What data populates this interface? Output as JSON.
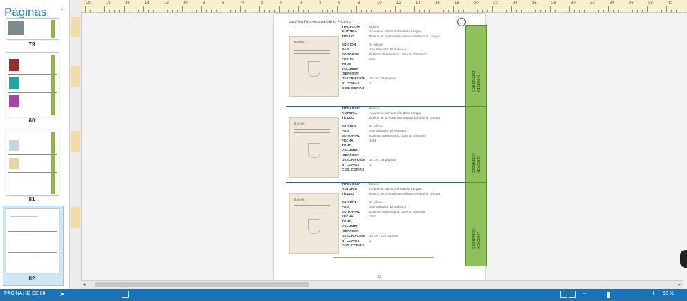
{
  "panel": {
    "title": "Páginas",
    "collapse_glyph": "‹",
    "thumbs": [
      {
        "page": "79"
      },
      {
        "page": "80"
      },
      {
        "page": "81"
      },
      {
        "page": "82",
        "selected": true
      }
    ]
  },
  "ruler": {
    "labels": [
      "20",
      "18",
      "16",
      "14",
      "12",
      "10",
      "8",
      "6",
      "4",
      "2",
      "0",
      "2",
      "4",
      "6",
      "8",
      "10",
      "12",
      "14",
      "16",
      "18",
      "20",
      "22",
      "24",
      "26",
      "28",
      "30",
      "32",
      "34",
      "36",
      "38",
      "40"
    ]
  },
  "document": {
    "header": "Archivo Documental de la Historia",
    "footer_page": "82",
    "field_labels": [
      "TIPOLOGÍA",
      "AUTORÍA",
      "TÍTULO",
      "EDICIÓN",
      "PAÍS",
      "EDITORIAL",
      "FECHA",
      "TOMO",
      "VOLUMEN",
      "ISBN/ISSN",
      "DESCRIPCIÓN",
      "Nº COPIAS",
      "COD. COPIAS"
    ],
    "entries": [
      {
        "cover_title": "Boletín",
        "values": [
          "Boletín",
          "Academia Salvadoreña de la Lengua",
          "Boletín de la Academia Salvadoreña de la Lengua",
          "1ª edición",
          "San Salvador, El Salvador",
          "Editorial Universitaria \"José B. Cisneros\"",
          "1964",
          "",
          "",
          "",
          "25 cm ; 45 páginas",
          "1",
          ""
        ],
        "code1": "CSB-BNS223",
        "code2": "HEM00346"
      },
      {
        "cover_title": "Boletín",
        "values": [
          "Boletín",
          "Academia Salvadoreña de la Lengua",
          "Boletín de la Academia Salvadoreña de la Lengua",
          "1ª edición",
          "San Salvador, El Salvador",
          "Editorial Universitaria \"José B. Cisneros\"",
          "1965",
          "",
          "",
          "",
          "25 cm ; 54 páginas",
          "1",
          ""
        ],
        "code1": "CSB-BNS224",
        "code2": "HEM00346"
      },
      {
        "cover_title": "Boletín",
        "values": [
          "Boletín",
          "Academia Salvadoreña de la Lengua",
          "Boletín de la Academia Salvadoreña de la Lengua",
          "1ª edición",
          "San Salvador, El Salvador",
          "Editorial Universitaria \"José B. Cisneros\"",
          "1967",
          "",
          "",
          "",
          "25 cm ; 104 páginas",
          "1",
          ""
        ],
        "code1": "CSB-BNS225",
        "code2": "HEM00347"
      }
    ]
  },
  "status": {
    "page_indicator": "PÁGINA: 82 DE 88",
    "zoom": "50 %",
    "zoom_minus": "−",
    "zoom_plus": "+",
    "accent": "#1a73b5"
  },
  "icons": {
    "cursor": "pointer-arrow-icon",
    "status_icon": "present-icon",
    "view1": "page-view-icon",
    "view2": "grid-view-icon"
  }
}
